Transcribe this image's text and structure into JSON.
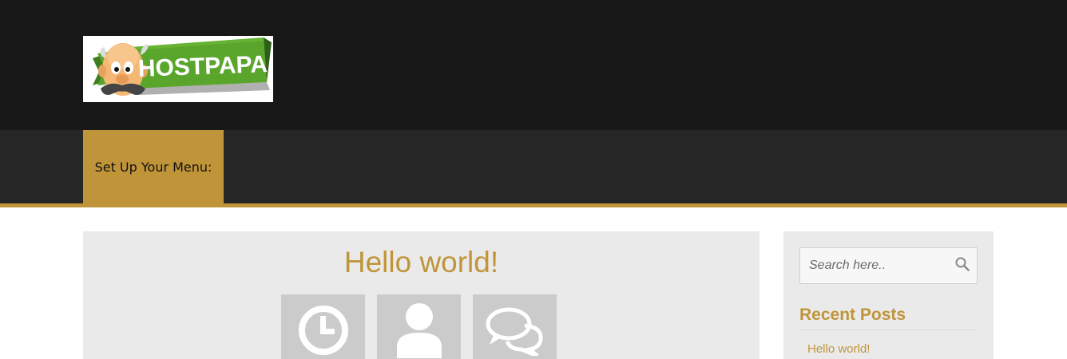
{
  "brand": {
    "logo_text": "HOSTPAPA"
  },
  "nav": {
    "menu_label": "Set Up Your Menu:"
  },
  "post": {
    "title": "Hello world!",
    "meta_icons": [
      "clock-icon",
      "user-icon",
      "comments-icon"
    ]
  },
  "sidebar": {
    "search": {
      "placeholder": "Search here..",
      "value": ""
    },
    "recent_posts": {
      "title": "Recent Posts",
      "items": [
        {
          "label": "Hello world!"
        }
      ]
    }
  },
  "colors": {
    "header_bg": "#181818",
    "nav_bg": "#262626",
    "accent": "#c0953a",
    "card_bg": "#eaeaea",
    "meta_box_bg": "#cbcbcb",
    "logo_green": "#5aa52c"
  }
}
